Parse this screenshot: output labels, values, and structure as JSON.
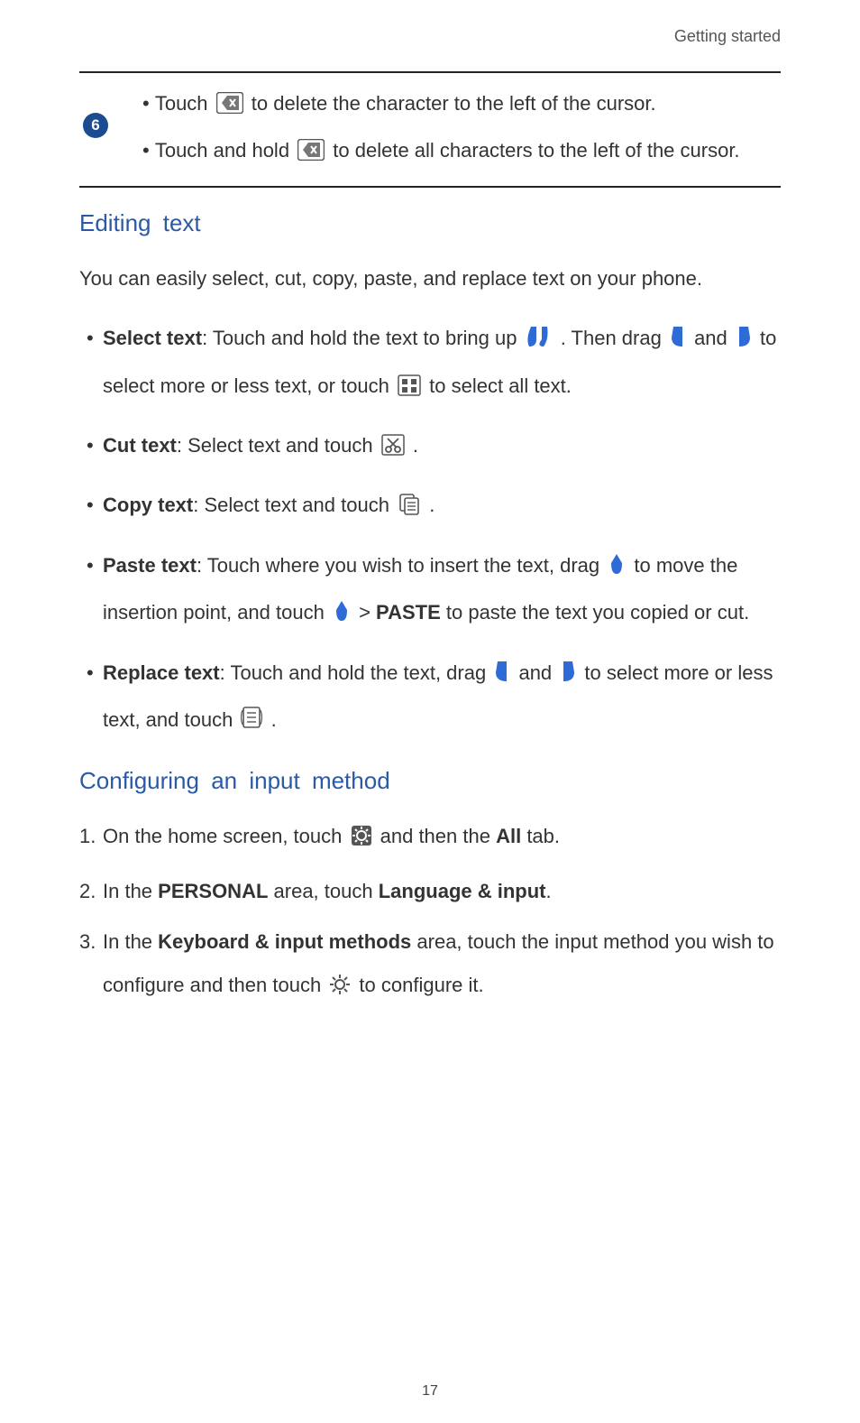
{
  "header": {
    "title": "Getting started"
  },
  "pageNumber": "17",
  "step6": {
    "number": "6",
    "line1_a": "Touch ",
    "line1_b": " to delete the character to the left of the cursor.",
    "line2_a": "Touch and hold ",
    "line2_b": " to delete all characters to the left of the cursor."
  },
  "sectionA": {
    "heading": "Editing text",
    "intro": "You can easily select, cut, copy, paste, and replace text on your phone.",
    "select": {
      "label": "Select text",
      "a": ": Touch and hold the text to bring up ",
      "b": ". Then drag ",
      "c": " and ",
      "d": " to select more or less text, or touch ",
      "e": " to select all text."
    },
    "cut": {
      "label": "Cut text",
      "a": ": Select text and touch ",
      "b": " ."
    },
    "copy": {
      "label": "Copy text",
      "a": ": Select text and touch ",
      "b": " ."
    },
    "paste": {
      "label": "Paste text",
      "a": ": Touch where you wish to insert the text, drag ",
      "b": " to move the insertion point, and touch ",
      "c": " > ",
      "paste_word": "PASTE",
      "d": " to paste the text you copied or cut."
    },
    "replace": {
      "label": "Replace text",
      "a": ": Touch and hold the text, drag ",
      "b": " and ",
      "c": " to select more or less text, and touch ",
      "d": " ."
    }
  },
  "sectionB": {
    "heading": "Configuring an input method",
    "s1a": "On the home screen, touch ",
    "s1b": " and then the ",
    "s1_all": "All",
    "s1c": " tab.",
    "s2a": "In the ",
    "s2_personal": "PERSONAL",
    "s2b": " area, touch ",
    "s2_lang": "Language & input",
    "s2c": ".",
    "s3a": "In the ",
    "s3_kbd": "Keyboard & input methods",
    "s3b": " area, touch the input method you wish to configure and then touch ",
    "s3c": " to configure it."
  },
  "icons": {
    "backspace": "backspace-icon",
    "handles": "selection-handles-icon",
    "handleL": "selection-handle-left-icon",
    "handleR": "selection-handle-right-icon",
    "selectAll": "select-all-icon",
    "cut": "cut-icon",
    "copy": "copy-icon",
    "cursor": "insertion-cursor-icon",
    "replace": "replace-icon",
    "settingsDark": "settings-dark-icon",
    "settingsLight": "settings-light-icon"
  }
}
